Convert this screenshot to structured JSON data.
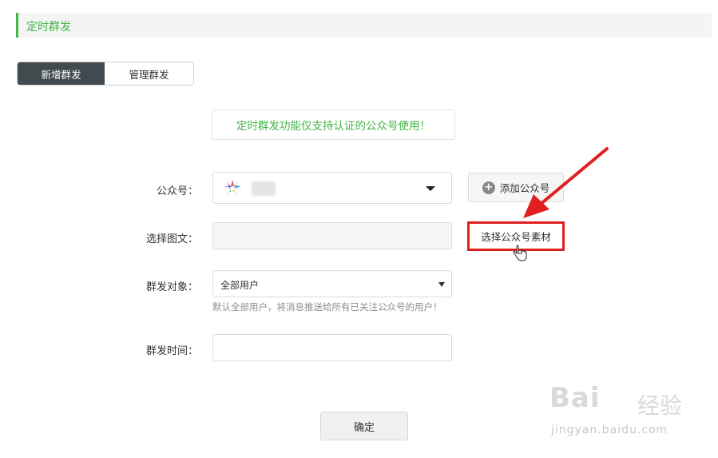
{
  "header": {
    "title": "定时群发"
  },
  "tabs": [
    {
      "label": "新增群发",
      "active": true
    },
    {
      "label": "管理群发",
      "active": false
    }
  ],
  "notice": {
    "text": "定时群发功能仅支持认证的公众号使用！"
  },
  "form": {
    "account_label": "公众号：",
    "account_name": "",
    "add_account_label": "添加公众号",
    "article_label": "选择图文：",
    "article_value": "",
    "select_material_label": "选择公众号素材",
    "target_label": "群发对象：",
    "target_value": "全部用户",
    "target_hint": "默认全部用户，将消息推送给所有已关注公众号的用户！",
    "time_label": "群发时间：",
    "time_value": ""
  },
  "confirm_label": "确定",
  "watermark": {
    "brand": "Bai",
    "brand_cn": "经验",
    "url": "jingyan.baidu.com"
  },
  "colors": {
    "accent": "#44b549",
    "annotation": "#e02020",
    "tab_active": "#414a4f"
  }
}
